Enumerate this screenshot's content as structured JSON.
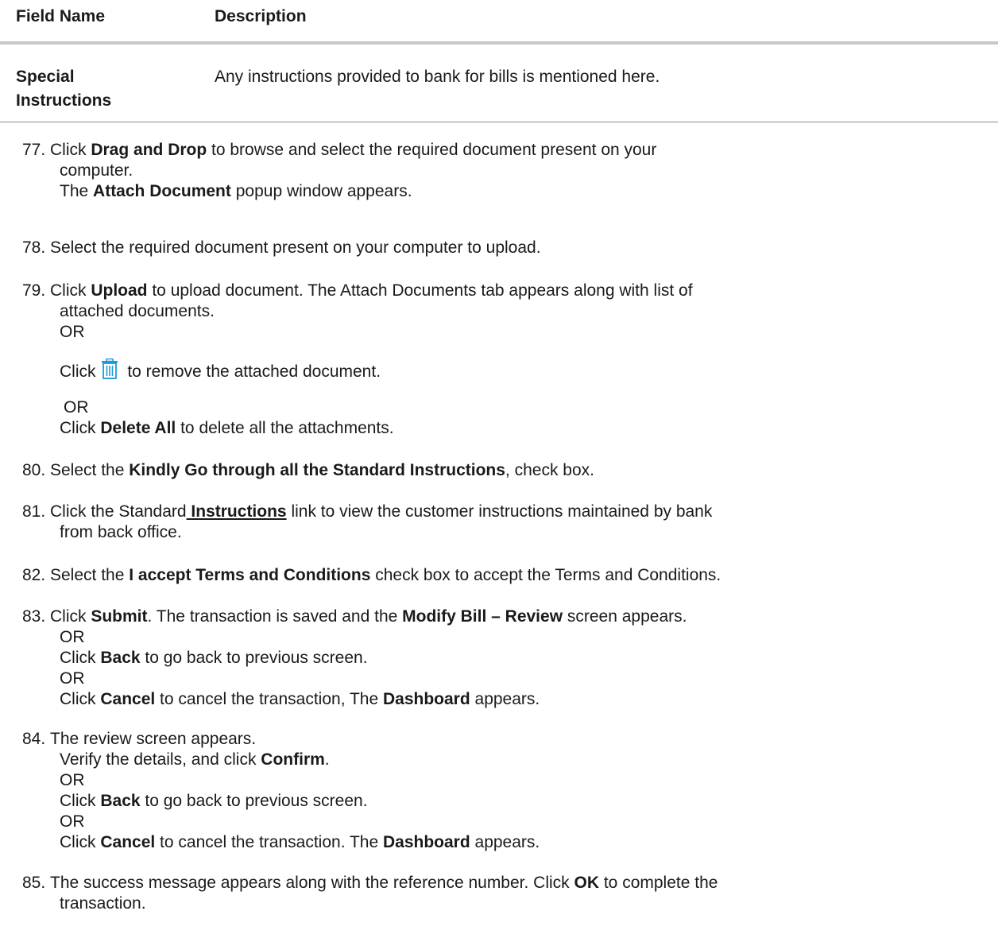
{
  "table": {
    "header_field": "Field Name",
    "header_description": "Description",
    "row_field_line1": "Special",
    "row_field_line2": "Instructions",
    "row_description": "Any instructions provided to bank for bills is mentioned here."
  },
  "steps": {
    "s77": {
      "num": "77.",
      "t1": "Click ",
      "b1": "Drag and Drop",
      "t2": " to browse and select the required document present on your",
      "t3": "computer.",
      "t4": "The ",
      "b2": "Attach Document",
      "t5": " popup window appears."
    },
    "s78": {
      "num": "78.",
      "t1": "Select the required document present on your computer to upload."
    },
    "s79": {
      "num": "79.",
      "t1": "Click ",
      "b1": "Upload",
      "t2": " to upload document. The Attach Documents tab appears along with list of",
      "t3": "attached documents.",
      "or1": "OR",
      "t4": "Click",
      "t5": " to remove the attached document.",
      "or2": "OR",
      "t6": "Click ",
      "b2": "Delete All",
      "t7": " to delete all the attachments."
    },
    "s80": {
      "num": "80.",
      "t1": "Select the ",
      "b1": "Kindly Go through all the Standard Instructions",
      "t2": ", check box."
    },
    "s81": {
      "num": "81.",
      "t1": "Click the Standard",
      "link": " Instructions",
      "t2": " link to view the customer instructions maintained by bank",
      "t3": "from back office."
    },
    "s82": {
      "num": "82.",
      "t1": "Select the ",
      "b1": "I accept Terms and Conditions",
      "t2": " check box to accept the Terms and Conditions."
    },
    "s83": {
      "num": "83.",
      "t1": "Click ",
      "b1": "Submit",
      "t2": ". The transaction is saved and the ",
      "b2": "Modify Bill – Review",
      "t3": " screen appears.",
      "or1": "OR",
      "t4": "Click ",
      "b3": "Back",
      "t5": " to go back to previous screen.",
      "or2": "OR",
      "t6": "Click ",
      "b4": "Cancel",
      "t7": " to cancel the transaction, The ",
      "b5": "Dashboard",
      "t8": " appears."
    },
    "s84": {
      "num": "84.",
      "t1": "The review screen appears.",
      "t2": "Verify the details, and click ",
      "b1": "Confirm",
      "t3": ".",
      "or1": "OR",
      "t4": "Click ",
      "b2": "Back",
      "t5": " to go back to previous screen.",
      "or2": "OR",
      "t6": "Click ",
      "b3": "Cancel",
      "t7": " to cancel the transaction. The ",
      "b4": "Dashboard",
      "t8": " appears."
    },
    "s85": {
      "num": "85.",
      "t1": "The success message appears along with the reference number. Click ",
      "b1": "OK",
      "t2": " to complete the",
      "t3": "transaction."
    }
  },
  "icons": {
    "trash": "trash-icon",
    "trash_color": "#1a9ad6"
  }
}
